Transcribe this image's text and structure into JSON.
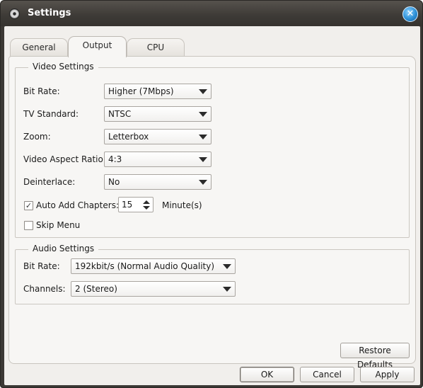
{
  "window": {
    "title": "Settings"
  },
  "tabs": [
    {
      "label": "General"
    },
    {
      "label": "Output"
    },
    {
      "label": "CPU"
    }
  ],
  "video_settings": {
    "group_label": "Video Settings",
    "bit_rate": {
      "label": "Bit Rate:",
      "value": "Higher (7Mbps)"
    },
    "tv_standard": {
      "label": "TV Standard:",
      "value": "NTSC"
    },
    "zoom": {
      "label": "Zoom:",
      "value": "Letterbox"
    },
    "aspect_ratio": {
      "label": "Video Aspect Ratio:",
      "value": "4:3"
    },
    "deinterlace": {
      "label": "Deinterlace:",
      "value": "No"
    },
    "auto_add_chapters": {
      "label": "Auto Add Chapters:",
      "checked": true,
      "value": "15",
      "unit": "Minute(s)"
    },
    "skip_menu": {
      "label": "Skip Menu",
      "checked": false
    }
  },
  "audio_settings": {
    "group_label": "Audio Settings",
    "bit_rate": {
      "label": "Bit Rate:",
      "value": "192kbit/s (Normal Audio Quality)"
    },
    "channels": {
      "label": "Channels:",
      "value": "2 (Stereo)"
    }
  },
  "buttons": {
    "restore_defaults": "Restore Defaults",
    "ok": "OK",
    "cancel": "Cancel",
    "apply": "Apply"
  },
  "icons": {
    "app": "disc-icon",
    "close": "close-icon",
    "check_mark": "✓",
    "close_glyph": "✕"
  }
}
